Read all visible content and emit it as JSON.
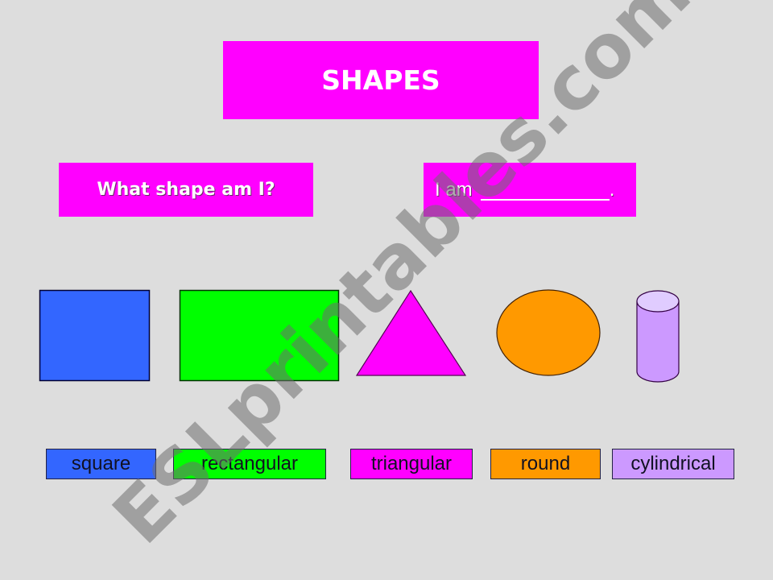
{
  "title": "SHAPES",
  "question": "What shape am I?",
  "answer_prompt": "I am",
  "answer_punctuation": ".",
  "shapes": [
    {
      "name": "square",
      "color": "#3366ff"
    },
    {
      "name": "rectangle",
      "color": "#00ff00"
    },
    {
      "name": "triangle",
      "color": "#ff00ff"
    },
    {
      "name": "circle",
      "color": "#ff9900"
    },
    {
      "name": "cylinder",
      "color": "#cc99ff"
    }
  ],
  "labels": [
    {
      "text": "square",
      "color": "#3366ff"
    },
    {
      "text": "rectangular",
      "color": "#00ff00"
    },
    {
      "text": "triangular",
      "color": "#ff00ff"
    },
    {
      "text": "round",
      "color": "#ff9900"
    },
    {
      "text": "cylindrical",
      "color": "#cc99ff"
    }
  ],
  "watermark": "ESLprintables.com"
}
